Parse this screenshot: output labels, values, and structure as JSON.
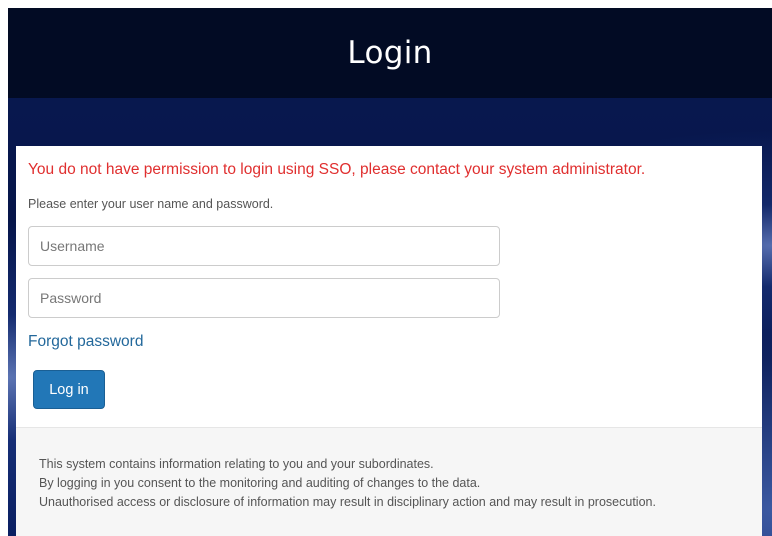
{
  "header": {
    "title": "Login"
  },
  "login_form": {
    "error_message": "You do not have permission to login using SSO, please contact your system administrator.",
    "instructions": "Please enter your user name and password.",
    "username": {
      "placeholder": "Username",
      "value": ""
    },
    "password": {
      "placeholder": "Password",
      "value": ""
    },
    "forgot_password_label": "Forgot password",
    "login_button_label": "Log in"
  },
  "notice": {
    "lines": [
      "This system contains information relating to you and your subordinates.",
      "By logging in you consent to the monitoring and auditing of changes to the data.",
      "Unauthorised access or disclosure of information may result in disciplinary action and may result in prosecution."
    ]
  },
  "colors": {
    "header_background": "#020b24",
    "error_text": "#e02f2f",
    "link": "#23689b",
    "primary_button": "#2277b7"
  }
}
